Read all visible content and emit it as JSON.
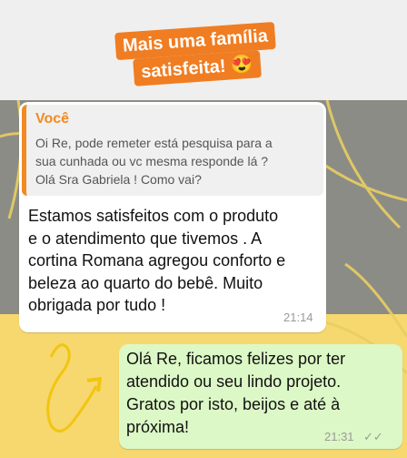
{
  "sticker": {
    "line1": "Mais uma família",
    "line2": "satisfeita! 😍"
  },
  "chat": {
    "quoted": {
      "author": "Você",
      "text": "Oi Re, pode remeter está pesquisa para a\nsua cunhada ou vc mesma responde lá ?\nOlá Sra Gabriela ! Como vai?"
    },
    "incoming": {
      "text": "Estamos satisfeitos com o produto\ne o atendimento que tivemos . A\ncortina Romana agregou conforto e\nbeleza ao quarto do bebê. Muito\nobrigada por tudo !",
      "time": "21:14"
    },
    "outgoing": {
      "text": "Olá Re, ficamos felizes por ter\natendido ou seu lindo projeto.\nGratos por isto, beijos e até à\npróxima!",
      "time": "21:31",
      "status_icon": "double-check-icon"
    }
  },
  "colors": {
    "sticker_bg": "#f07d22",
    "quote_accent": "#f08a24",
    "chat_bg": "#f6d86f",
    "outgoing_bubble": "#dcf8c6"
  }
}
